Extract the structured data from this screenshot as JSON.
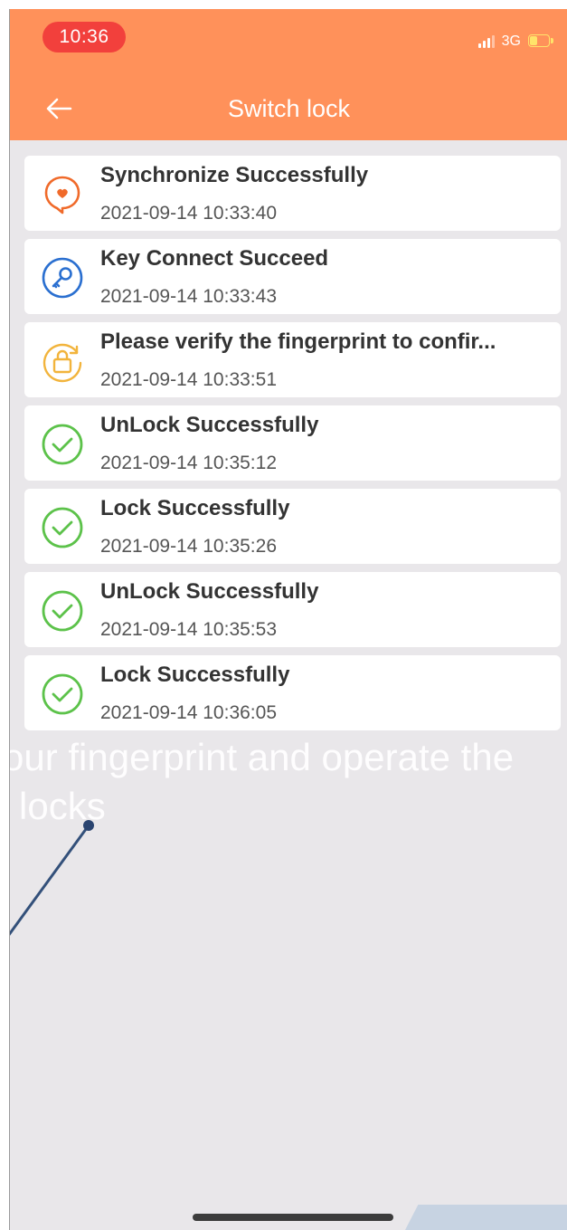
{
  "status_bar": {
    "time": "10:36",
    "network": "3G"
  },
  "nav": {
    "title": "Switch lock"
  },
  "records": [
    {
      "icon": "lock-heart-icon",
      "title": "Synchronize Successfully",
      "time": "2021-09-14 10:33:40"
    },
    {
      "icon": "key-connect-icon",
      "title": "Key Connect Succeed",
      "time": "2021-09-14 10:33:43"
    },
    {
      "icon": "padlock-refresh-icon",
      "title": "Please verify the fingerprint to confir...",
      "time": "2021-09-14 10:33:51"
    },
    {
      "icon": "check-circle-icon",
      "title": "UnLock Successfully",
      "time": "2021-09-14 10:35:12"
    },
    {
      "icon": "check-circle-icon",
      "title": "Lock Successfully",
      "time": "2021-09-14 10:35:26"
    },
    {
      "icon": "check-circle-icon",
      "title": "UnLock Successfully",
      "time": "2021-09-14 10:35:53"
    },
    {
      "icon": "check-circle-icon",
      "title": "Lock Successfully",
      "time": "2021-09-14 10:36:05"
    }
  ],
  "overlay": {
    "line1": "our fingerprint and operate the",
    "line2": "locks"
  },
  "colors": {
    "header": "#ff915a",
    "time_pill": "#f2403c",
    "sync_icon": "#f06a2a",
    "key_icon": "#2a6fd0",
    "verify_icon": "#f2b43c",
    "success_icon": "#5cc24a",
    "background": "#e9e7ea"
  }
}
